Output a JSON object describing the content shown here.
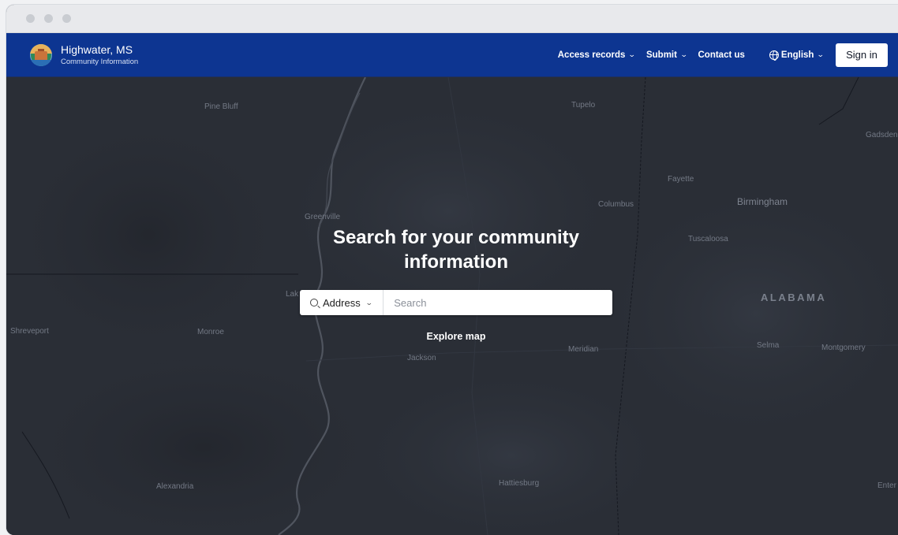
{
  "header": {
    "title": "Highwater, MS",
    "subtitle": "Community Information",
    "nav": {
      "access_records": "Access records",
      "submit": "Submit",
      "contact": "Contact us",
      "language": "English",
      "signin": "Sign in"
    }
  },
  "hero": {
    "title": "Search for your community information",
    "search_type": "Address",
    "search_placeholder": "Search",
    "explore": "Explore map"
  },
  "map_labels": {
    "pine_bluff": "Pine Bluff",
    "tupelo": "Tupelo",
    "gadsden": "Gadsden",
    "fayette": "Fayette",
    "greenville": "Greenville",
    "columbus": "Columbus",
    "birmingham": "Birmingham",
    "tuscaloosa": "Tuscaloosa",
    "alabama": "ALABAMA",
    "shreveport": "Shreveport",
    "monroe": "Monroe",
    "jackson": "Jackson",
    "meridian": "Meridian",
    "selma": "Selma",
    "montgomery": "Montgomery",
    "alexandria": "Alexandria",
    "hattiesburg": "Hattiesburg",
    "enterprise": "Enter",
    "lake": "Lak"
  },
  "colors": {
    "nav_bg": "#0d3591",
    "map_bg": "#2a2e36"
  }
}
